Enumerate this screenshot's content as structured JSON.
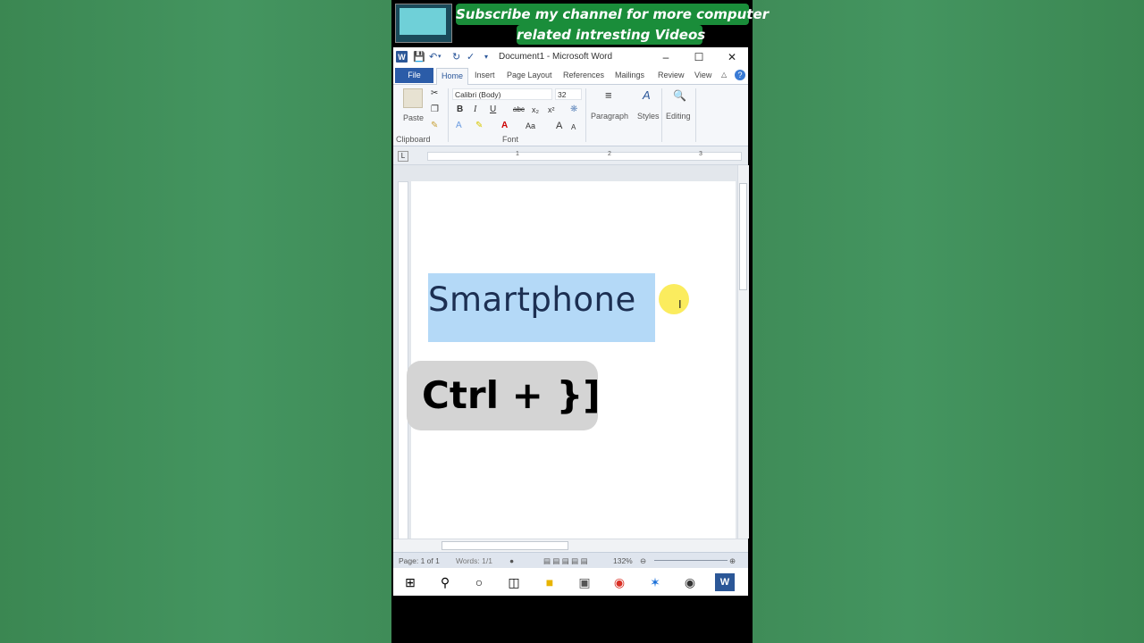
{
  "banner": {
    "line1": "Subscribe my channel for more computer",
    "line2": "related intresting Videos"
  },
  "word": {
    "title": "Document1 - Microsoft Word",
    "tabs": {
      "file": "File",
      "home": "Home",
      "insert": "Insert",
      "page_layout": "Page Layout",
      "references": "References",
      "mailings": "Mailings",
      "review": "Review",
      "view": "View"
    },
    "ribbon": {
      "paste": "Paste",
      "clipboard": "Clipboard",
      "font_name": "Calibri (Body)",
      "font_size": "32",
      "font_group": "Font",
      "paragraph": "Paragraph",
      "styles": "Styles",
      "editing": "Editing",
      "bold": "B",
      "italic": "I",
      "underline": "U",
      "strike": "abc",
      "subscript": "x₂",
      "superscript": "x²",
      "case": "Aa",
      "grow": "A",
      "shrink": "A"
    },
    "ruler_marks": [
      "1",
      "2",
      "3"
    ],
    "document_text": "Smartphone",
    "status": {
      "page": "Page: 1 of 1",
      "words": "Words: 1/1",
      "zoom": "132%"
    }
  },
  "overlay": {
    "shortcut": "Ctrl + }]"
  },
  "colors": {
    "accent": "#2b579a",
    "selection": "#b4d9f7",
    "banner": "#1a8d3a"
  }
}
